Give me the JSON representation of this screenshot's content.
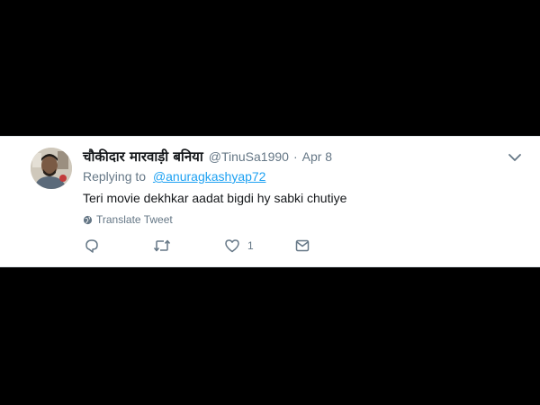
{
  "tweet": {
    "display_name": "चौकीदार मारवाड़ी बनिया",
    "handle": "@TinuSa1990",
    "separator": "·",
    "timestamp": "Apr 8",
    "replying_to_label": "Replying to",
    "replying_to_mention": "@anuragkashyap72",
    "text": "Teri movie dekhkar aadat bigdi hy sabki chutiye",
    "translate_label": "Translate Tweet",
    "actions": {
      "reply_icon": "reply-icon",
      "retweet_icon": "retweet-icon",
      "like_icon": "heart-icon",
      "like_count": "1",
      "dm_icon": "envelope-icon"
    }
  },
  "colors": {
    "background": "#000000",
    "card": "#ffffff",
    "name_text": "#14171a",
    "muted_text": "#657786",
    "link": "#1da1f2"
  }
}
